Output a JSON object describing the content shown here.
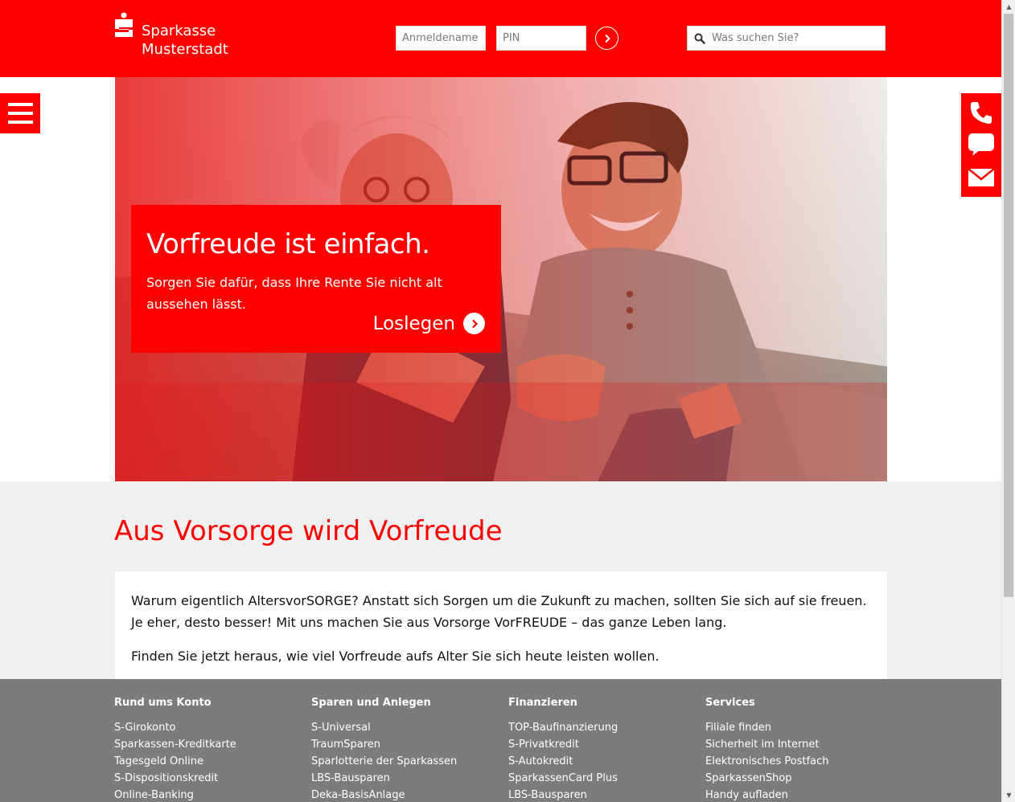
{
  "brand": {
    "line1": "Sparkasse",
    "line2": "Musterstadt"
  },
  "login": {
    "username_placeholder": "Anmeldename",
    "pin_placeholder": "PIN",
    "submit_icon": "chevron-right-circle-icon"
  },
  "search": {
    "placeholder": "Was suchen Sie?",
    "icon": "search-icon"
  },
  "menu": {
    "icon": "hamburger-icon"
  },
  "contact": {
    "icons": [
      "phone-icon",
      "chat-icon",
      "mail-icon"
    ]
  },
  "hero": {
    "title": "Vorfreude ist einfach.",
    "text": "Sorgen Sie dafür, dass Ihre Rente Sie nicht alt aussehen lässt.",
    "cta": "Loslegen"
  },
  "main": {
    "heading": "Aus Vorsorge wird Vorfreude",
    "paragraph1": "Warum eigentlich AltersvorSORGE? Anstatt sich Sorgen um die Zukunft zu machen, sollten Sie sich auf sie freuen. Je eher, desto besser! Mit uns machen Sie aus Vorsorge VorFREUDE – das ganze Leben lang.",
    "paragraph2": "Finden Sie jetzt heraus, wie viel Vorfreude aufs Alter Sie sich heute leisten wollen."
  },
  "footer": {
    "columns": [
      {
        "title": "Rund ums Konto",
        "links": [
          "S-Girokonto",
          "Sparkassen-Kreditkarte",
          "Tagesgeld Online",
          "S-Dispositionskredit",
          "Online-Banking"
        ]
      },
      {
        "title": "Sparen und Anlegen",
        "links": [
          "S-Universal",
          "TraumSparen",
          "Sparlotterie der Sparkassen",
          "LBS-Bausparen",
          "Deka-BasisAnlage"
        ]
      },
      {
        "title": "Finanzieren",
        "links": [
          "TOP-Baufinanzierung",
          "S-Privatkredit",
          "S-Autokredit",
          "SparkassenCard Plus",
          "LBS-Bausparen"
        ]
      },
      {
        "title": "Services",
        "links": [
          "Filiale finden",
          "Sicherheit im Internet",
          "Elektronisches Postfach",
          "SparkassenShop",
          "Handy aufladen"
        ]
      }
    ]
  },
  "colors": {
    "brand_red": "#ff0000",
    "footer_gray": "#7c7c7c",
    "page_bg": "#f0f0f0"
  }
}
